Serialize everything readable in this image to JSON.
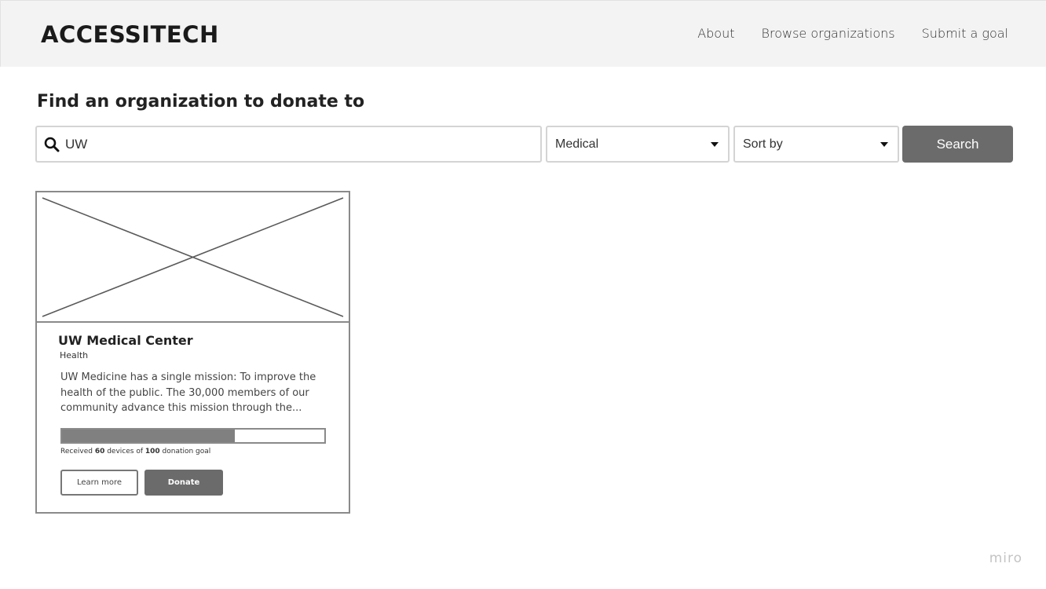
{
  "header": {
    "logo": "ACCESSITECH",
    "nav": [
      {
        "label": "About"
      },
      {
        "label": "Browse organizations"
      },
      {
        "label": "Submit a goal"
      }
    ]
  },
  "page": {
    "title": "Find an organization to donate to"
  },
  "search": {
    "value": "UW",
    "icon": "search-icon",
    "category_selected": "Medical",
    "sort_selected": "Sort by",
    "button_label": "Search"
  },
  "results": [
    {
      "title": "UW Medical Center",
      "category": "Health",
      "description": "UW Medicine has a single mission: To improve the health of the public. The 30,000 members of our community advance this mission through the...",
      "progress_prefix": "Received ",
      "received": "60",
      "progress_middle": " devices of ",
      "goal": "100",
      "progress_suffix": " donation goal",
      "progress_fraction": 0.66,
      "learn_more_label": "Learn more",
      "donate_label": "Donate"
    }
  ],
  "watermark": "miro",
  "colors": {
    "header_bg": "#f3f3f3",
    "button_bg": "#6b6b6b",
    "progress_fill": "#808080"
  }
}
